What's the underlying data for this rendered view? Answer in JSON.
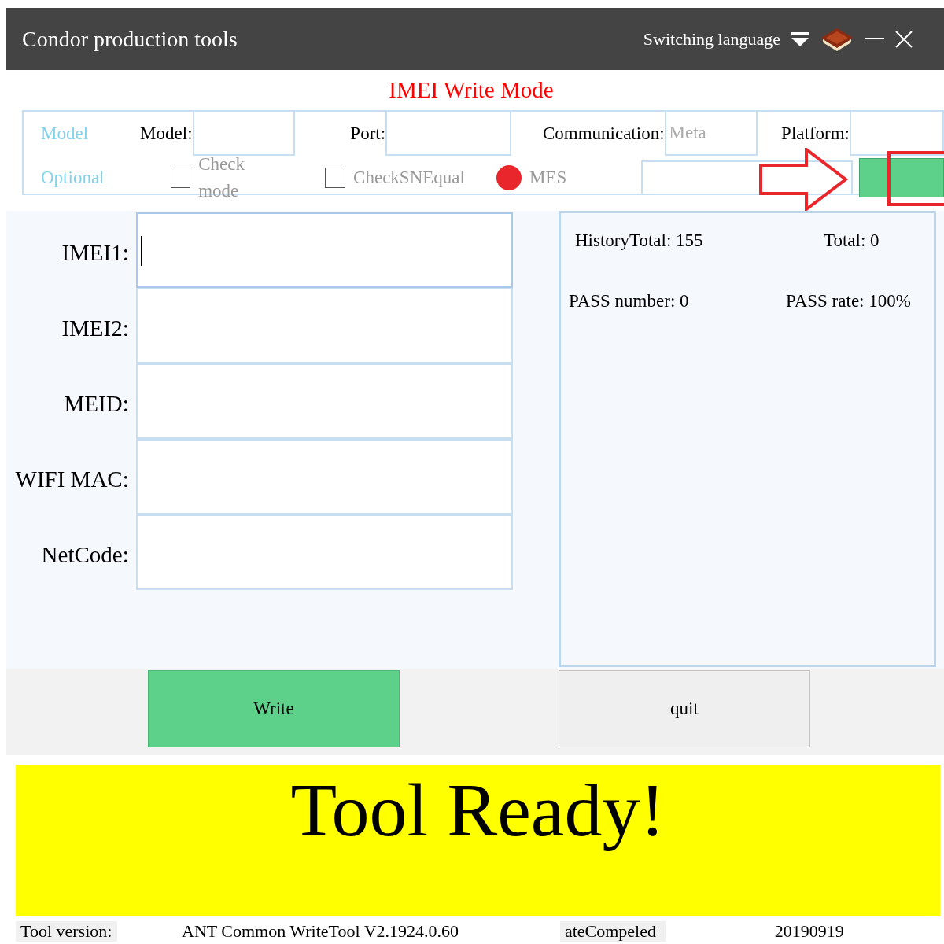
{
  "window": {
    "title": "Condor production tools",
    "language_menu": "Switching language"
  },
  "mode_title": "IMEI Write Mode",
  "config": {
    "model_group": "Model",
    "optional_group": "Optional",
    "fields": [
      {
        "label": "Model:"
      },
      {
        "label": "Port:"
      },
      {
        "label": "Communication:",
        "placeholder": "Meta"
      },
      {
        "label": "Platform:"
      }
    ],
    "options": [
      {
        "kind": "checkbox",
        "label": "Check mode",
        "checked": false
      },
      {
        "kind": "checkbox",
        "label": "CheckSNEqual",
        "checked": false
      },
      {
        "kind": "status",
        "label": "MES",
        "color": "#e8262b"
      }
    ]
  },
  "inputs": [
    {
      "label": "IMEI1:",
      "focused": true
    },
    {
      "label": "IMEI2:",
      "focused": false
    },
    {
      "label": "MEID:",
      "focused": false
    },
    {
      "label": "WIFI MAC:",
      "focused": false
    },
    {
      "label": "NetCode:",
      "focused": false
    }
  ],
  "stats": [
    {
      "text": "HistoryTotal: 155"
    },
    {
      "text": "Total: 0"
    },
    {
      "text": "PASS number: 0"
    },
    {
      "text": "PASS rate: 100%"
    }
  ],
  "buttons": [
    {
      "kind": "primary",
      "label": "Write"
    },
    {
      "kind": "secondary",
      "label": "quit"
    }
  ],
  "banner": "Tool Ready!",
  "footer": [
    {
      "kind": "label",
      "text": "Tool version:"
    },
    {
      "kind": "value",
      "text": "ANT  Common  WriteTool V2.1924.0.60"
    },
    {
      "kind": "label",
      "text": "ateCompeled"
    },
    {
      "kind": "value",
      "text": "20190919"
    }
  ]
}
